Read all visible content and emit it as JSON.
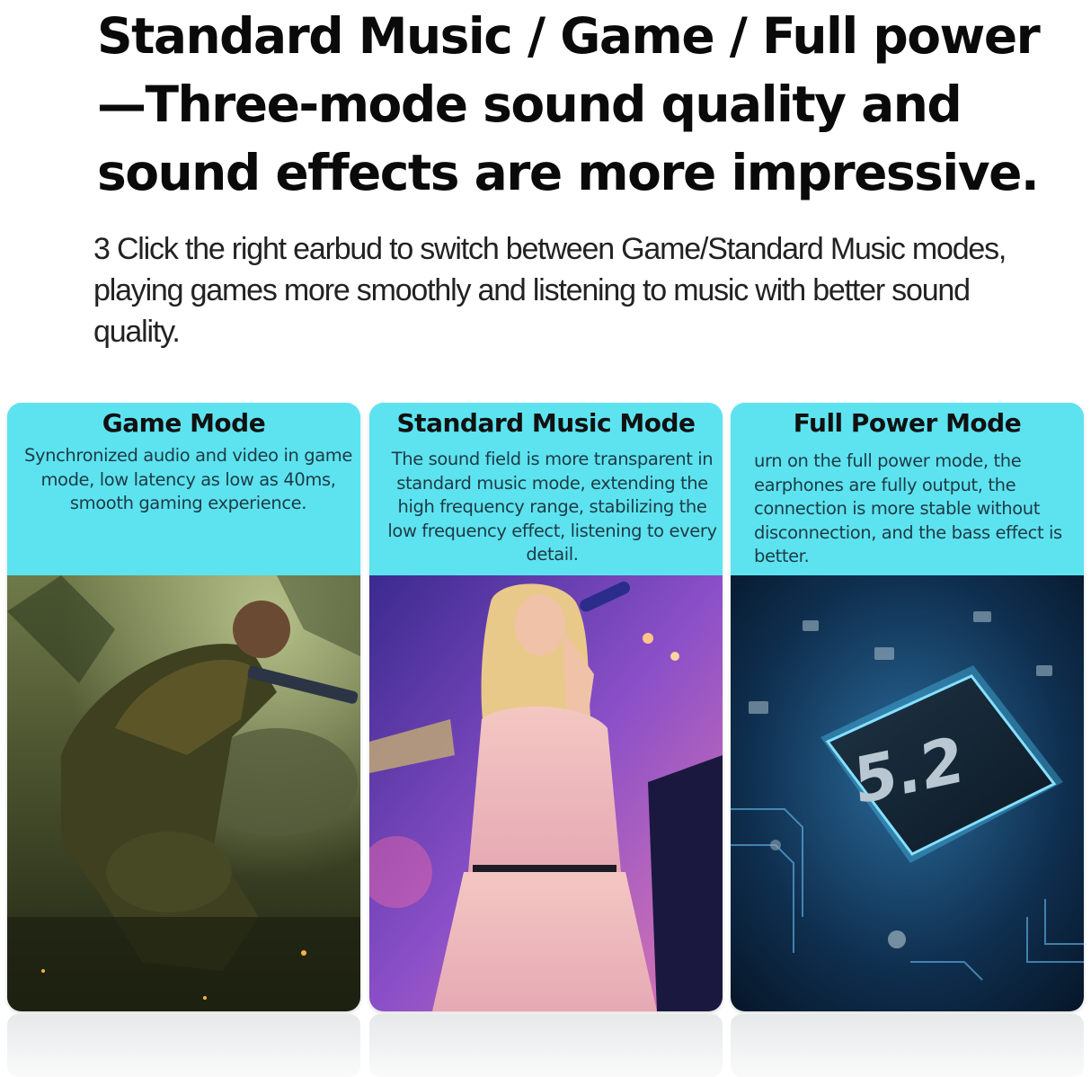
{
  "headline": {
    "line1": "Standard Music / Game / Full power",
    "line2": "—Three-mode sound quality and",
    "line3": "sound effects are more impressive."
  },
  "description": "3 Click the right earbud to switch between Game/Standard Music modes, playing games more smoothly and listening to music with better sound quality.",
  "cards": [
    {
      "title": "Game Mode",
      "text": "Synchronized audio and video in game mode, low latency as low as 40ms, smooth gaming experience."
    },
    {
      "title": "Standard Music Mode",
      "text": "The sound field is more transparent in standard music mode, extending the high frequency range, stabilizing the low frequency effect, listening to every detail."
    },
    {
      "title": "Full Power Mode",
      "text": "urn on the full power mode, the earphones are fully output, the connection is more stable without disconnection, and the bass effect is better.",
      "image_label": "5.2"
    }
  ],
  "colors": {
    "card_header": "#5de3f0",
    "headline": "#0a0a0a"
  }
}
